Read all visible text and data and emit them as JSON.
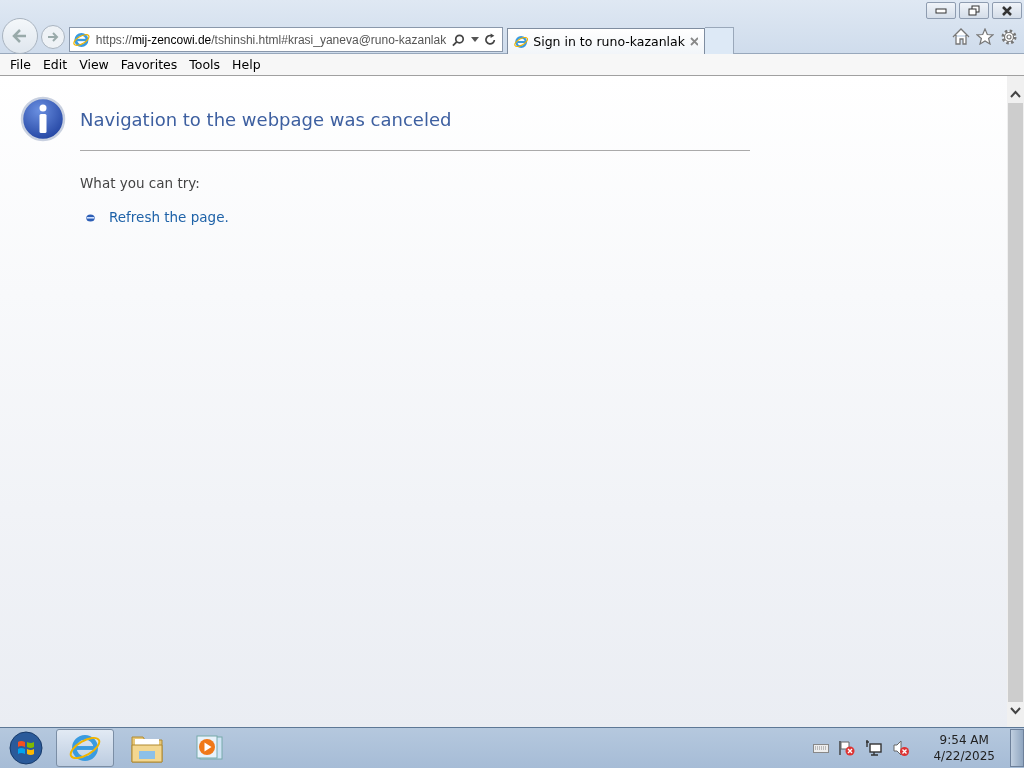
{
  "address_bar": {
    "scheme": "https://",
    "domain": "mij-zencowi.de",
    "path": "/tshinshi.html#krasi_yaneva@runo-kazanlak"
  },
  "tabs": [
    {
      "title": "Sign in to runo-kazanlak",
      "selected": true
    }
  ],
  "menu": [
    "File",
    "Edit",
    "View",
    "Favorites",
    "Tools",
    "Help"
  ],
  "page": {
    "heading": "Navigation to the webpage was canceled",
    "subheading": "What you can try:",
    "suggestions": [
      "Refresh the page."
    ]
  },
  "taskbar": {
    "apps": [
      {
        "kind": "browser",
        "selected": true
      },
      {
        "kind": "folder",
        "selected": false
      },
      {
        "kind": "media",
        "selected": false
      }
    ],
    "clock": {
      "time": "9:54 AM",
      "date": "4/22/2025"
    }
  }
}
